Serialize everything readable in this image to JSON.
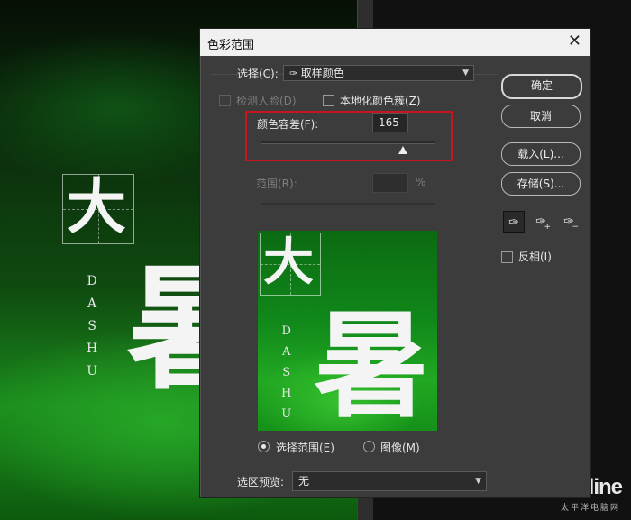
{
  "background": {
    "char_da": "大",
    "char_shu": "暑",
    "vertical_text": [
      "D",
      "A",
      "S",
      "H",
      "U"
    ],
    "logo": "PConline",
    "logo_sub": "太平洋电脑网"
  },
  "dialog": {
    "title": "色彩范围",
    "select_label": "选择(C):",
    "select_value": "取样颜色",
    "detect_faces": "检测人脸(D)",
    "localized_clusters": "本地化颜色簇(Z)",
    "fuzziness_label": "颜色容差(F):",
    "fuzziness_value": "165",
    "fuzziness_fraction": 0.8125,
    "range_label": "范围(R):",
    "range_unit": "%",
    "buttons": {
      "ok": "确定",
      "cancel": "取消",
      "load": "载入(L)...",
      "save": "存储(S)..."
    },
    "invert_label": "反相(I)",
    "preview_chars": {
      "da": "大",
      "shu": "暑",
      "vertical": [
        "D",
        "A",
        "S",
        "H",
        "U"
      ]
    },
    "radio_selection": "选择范围(E)",
    "radio_image": "图像(M)",
    "selection_preview_label": "选区预览:",
    "selection_preview_value": "无",
    "icons": [
      "eyedropper-icon",
      "eyedropper-plus-icon",
      "eyedropper-minus-icon"
    ]
  },
  "colors": {
    "highlight_box": "#c8141b",
    "dialog_bg": "#3c3c3c"
  }
}
